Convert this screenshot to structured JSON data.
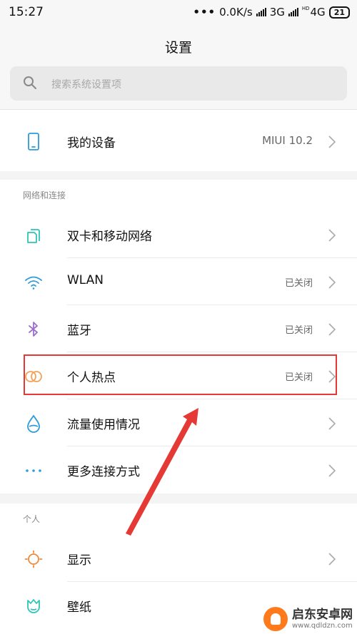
{
  "status_bar": {
    "time": "15:27",
    "dots": "•••",
    "speed": "0.0K/s",
    "net1": "3G",
    "net2_hd": "HD",
    "net2": "4G",
    "battery": "21"
  },
  "header": {
    "title": "设置"
  },
  "search": {
    "placeholder": "搜索系统设置项"
  },
  "my_device": {
    "label": "我的设备",
    "value": "MIUI 10.2",
    "icon": "phone-icon"
  },
  "network_section": {
    "title": "网络和连接",
    "items": [
      {
        "label": "双卡和移动网络",
        "value": "",
        "icon": "dual-sim-icon",
        "color": "#2fc5b8"
      },
      {
        "label": "WLAN",
        "value": "已关闭",
        "icon": "wifi-icon",
        "color": "#2f9bd8"
      },
      {
        "label": "蓝牙",
        "value": "已关闭",
        "icon": "bluetooth-icon",
        "color": "#9b6fcf"
      },
      {
        "label": "个人热点",
        "value": "已关闭",
        "icon": "hotspot-icon",
        "color": "#f3a25a"
      },
      {
        "label": "流量使用情况",
        "value": "",
        "icon": "data-usage-icon",
        "color": "#2f9bd8"
      },
      {
        "label": "更多连接方式",
        "value": "",
        "icon": "more-dots-icon",
        "color": "#2f9bd8"
      }
    ]
  },
  "personal_section": {
    "title": "个人",
    "items": [
      {
        "label": "显示",
        "value": "",
        "icon": "sun-icon",
        "color": "#f08a3c"
      },
      {
        "label": "壁纸",
        "value": "",
        "icon": "tulip-icon",
        "color": "#2fc5b8"
      }
    ]
  },
  "watermark": {
    "name": "启东安卓网",
    "url": "www.qdldzn.com"
  },
  "colors": {
    "accent_red": "#e53935",
    "background": "#f4f4f4"
  }
}
